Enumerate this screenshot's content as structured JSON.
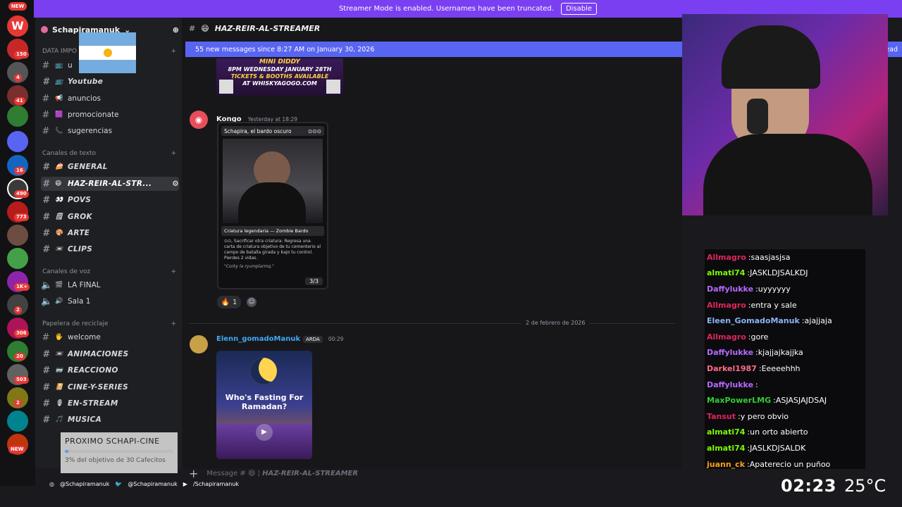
{
  "banner": {
    "text": "Streamer Mode is enabled. Usernames have been truncated.",
    "button": "Disable"
  },
  "rail": {
    "new_label": "NEW",
    "badges": [
      "150",
      "4",
      "41",
      "16",
      "490",
      "773",
      "1K+",
      "2",
      "306",
      "20",
      "503",
      "2",
      "NEW"
    ]
  },
  "server": {
    "name": "Schapiramanuk",
    "chevron": "⌄"
  },
  "categories": {
    "data": "DATA IMPO",
    "texto": "Canales de texto",
    "voz": "Canales de voz",
    "reciclaje": "Papelera de reciclaje"
  },
  "channels": [
    {
      "icon": "📺",
      "name": "u"
    },
    {
      "icon": "📺",
      "name": "Youtube"
    },
    {
      "icon": "📢",
      "name": "anuncios"
    },
    {
      "icon": "🟪",
      "name": "promocionate"
    },
    {
      "icon": "📞",
      "name": "sugerencias"
    },
    {
      "icon": "🍰",
      "name": "GENERAL"
    },
    {
      "icon": "😄",
      "name": "HAZ-REIR-AL-STR..."
    },
    {
      "icon": "👀",
      "name": "POVS"
    },
    {
      "icon": "🗒",
      "name": "GROK"
    },
    {
      "icon": "🎨",
      "name": "ARTE"
    },
    {
      "icon": "📼",
      "name": "CLIPS"
    },
    {
      "icon": "🎬",
      "name": "LA FINAL"
    },
    {
      "icon": "🔊",
      "name": "Sala 1"
    },
    {
      "icon": "🖐",
      "name": "welcome"
    },
    {
      "icon": "📼",
      "name": "ANIMACIONES"
    },
    {
      "icon": "🥽",
      "name": "REACCIONO"
    },
    {
      "icon": "📔",
      "name": "CINE-Y-SERIES"
    },
    {
      "icon": "🎙",
      "name": "EN-STREAM"
    },
    {
      "icon": "🎵",
      "name": "MUSICA"
    }
  ],
  "header": {
    "channel": "HAZ-REIR-AL-STREAMER",
    "emoji": "😄"
  },
  "newbar": {
    "text": "55 new messages since 8:27 AM on January 30, 2026",
    "right": "ead"
  },
  "poster": {
    "line1": "MINI DIDDY",
    "line2": "8PM WEDNESDAY JANUARY 28TH",
    "line3": "TICKETS & BOOTHS AVAILABLE",
    "line4": "AT WHISKYAGOGO.COM"
  },
  "msg1": {
    "author": "Kongo",
    "time": "Yesterday at 18:29",
    "reaction_count": "1"
  },
  "card": {
    "title": "Schapira, el bardo oscuro",
    "cost": "⊙⊙⊙",
    "type": "Criatura legendaria — Zombie Bardo",
    "text": "⊙⊙, Sacrificar otra criatura: Regresa una carta de criatura objetivo de tu cementerio al campo de batalla girada y bajo tu control. Pierdes 2 vidas.",
    "flavor": "\"Corky la ryumplarmq.\"",
    "pt": "3/3"
  },
  "date_divider": "2 de febrero de 2026",
  "msg2": {
    "author": "Elenn_gomadoManuk",
    "tag": "ARDA",
    "time": "00:29",
    "image_text": "Who's Fasting For Ramadan?"
  },
  "composer": {
    "placeholder": "Message #",
    "channel": "HAZ-REIR-AL-STREAMER"
  },
  "goal": {
    "title": "PROXIMO SCHAPI-CINE",
    "progress": 0.03,
    "text": "3% del objetivo de 30 Cafecitos"
  },
  "chat": [
    {
      "user": "Allmagro",
      "color": "#e0245e",
      "msg": "saasjasjsa"
    },
    {
      "user": "almati74",
      "color": "#7cfc00",
      "msg": "JASKLDJSALKDJ"
    },
    {
      "user": "Daffylukke",
      "color": "#b469ff",
      "msg": "uyyyyyy"
    },
    {
      "user": "Allmagro",
      "color": "#e0245e",
      "msg": "entra y sale"
    },
    {
      "user": "Eleen_GomadoManuk",
      "color": "#8ab4f8",
      "msg": "ajajjaja"
    },
    {
      "user": "Allmagro",
      "color": "#e0245e",
      "msg": "gore"
    },
    {
      "user": "Daffylukke",
      "color": "#b469ff",
      "msg": "kjajjajkajjka"
    },
    {
      "user": "Darkel1987",
      "color": "#ff6b8a",
      "msg": "Eeeeehhh"
    },
    {
      "user": "Daffylukke",
      "color": "#b469ff",
      "msg": ""
    },
    {
      "user": "MaxPowerLMG",
      "color": "#32cd32",
      "msg": "ASJASJAJDSAJ"
    },
    {
      "user": "Tansut",
      "color": "#e0245e",
      "msg": "y pero obvio"
    },
    {
      "user": "almati74",
      "color": "#7cfc00",
      "msg": "un orto abierto"
    },
    {
      "user": "almati74",
      "color": "#7cfc00",
      "msg": "JASLKDJSALDK"
    },
    {
      "user": "juann_ck",
      "color": "#ff9f1a",
      "msg": "Apaterecio un puñoo"
    }
  ],
  "overlay": {
    "clock": "02:23",
    "temp": "25°C"
  },
  "socials": [
    "@Schapiramanuk",
    "@Schapiramanuk",
    "/Schapiramanuk"
  ]
}
